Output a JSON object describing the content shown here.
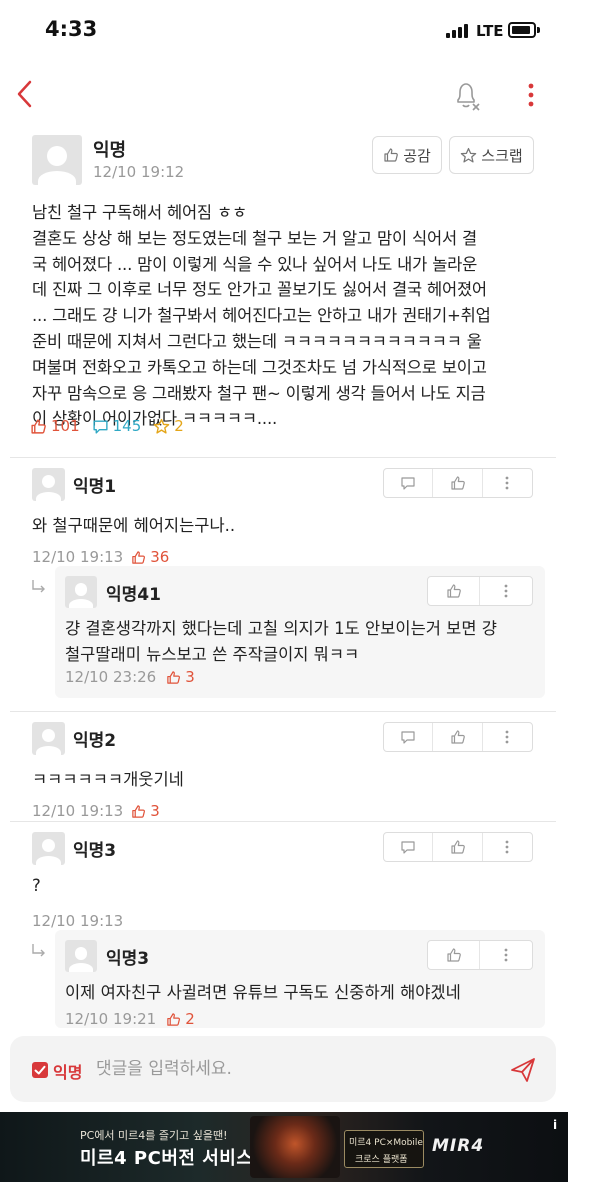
{
  "status_bar": {
    "time": "4:33",
    "network": "LTE"
  },
  "colors": {
    "accent": "#d8383a",
    "like": "#e0533a",
    "comment": "#2fa8c4",
    "scrap": "#e4a61a"
  },
  "post": {
    "author": "익명",
    "date": "12/10 19:12",
    "empathy_label": "공감",
    "scrap_label": "스크랩",
    "body": "남친 철구 구독해서 헤어짐 ㅎㅎ\n결혼도 상상 해 보는 정도였는데 철구 보는 거 알고 맘이 식어서 결\n국 헤어졌다 ... 맘이 이렇게 식을 수 있나 싶어서 나도 내가 놀라운\n데 진짜 그 이후로 너무 정도 안가고 꼴보기도 싫어서 결국 헤어졌어\n... 그래도 걍 니가 철구봐서 헤어진다고는 안하고 내가 권태기+취업\n준비 때문에 지쳐서 그런다고 했는데 ㅋㅋㅋㅋㅋㅋㅋㅋㅋㅋㅋㅋ 울\n며불며 전화오고 카톡오고 하는데 그것조차도 넘 가식적으로 보이고\n자꾸 맘속으로 응 그래봤자 철구 팬~ 이렇게 생각 들어서 나도 지금\n이 상황이 어이가없다 ㅋㅋㅋㅋㅋ....",
    "likes": "101",
    "comments": "145",
    "scraps": "2"
  },
  "comments": [
    {
      "author": "익명1",
      "text": "와 철구때문에 헤어지는구나..",
      "date": "12/10 19:13",
      "likes": "36",
      "reply": {
        "author": "익명41",
        "text": "걍 결혼생각까지 했다는데 고칠 의지가 1도 안보이는거 보면 걍\n철구딸래미 뉴스보고 쓴 주작글이지 뭐ㅋㅋ",
        "date": "12/10 23:26",
        "likes": "3"
      }
    },
    {
      "author": "익명2",
      "text": "ㅋㅋㅋㅋㅋㅋ개웃기네",
      "date": "12/10 19:13",
      "likes": "3"
    },
    {
      "author": "익명3",
      "text": "?",
      "date": "12/10 19:13",
      "reply": {
        "author": "익명3",
        "text": "이제 여자친구 사귈려면 유튜브 구독도 신중하게 해야겠네",
        "date": "12/10 19:21",
        "likes": "2"
      }
    }
  ],
  "input": {
    "anon_label": "익명",
    "placeholder": "댓글을 입력하세요."
  },
  "ad": {
    "line1": "PC에서 미르4를 즐기고 싶을땐!",
    "line2": "미르4 PC버전 서비스",
    "box_line1": "미르4 PC×Mobile",
    "box_line2": "크로스 플랫폼",
    "logo": "MIR4",
    "info": "i"
  }
}
